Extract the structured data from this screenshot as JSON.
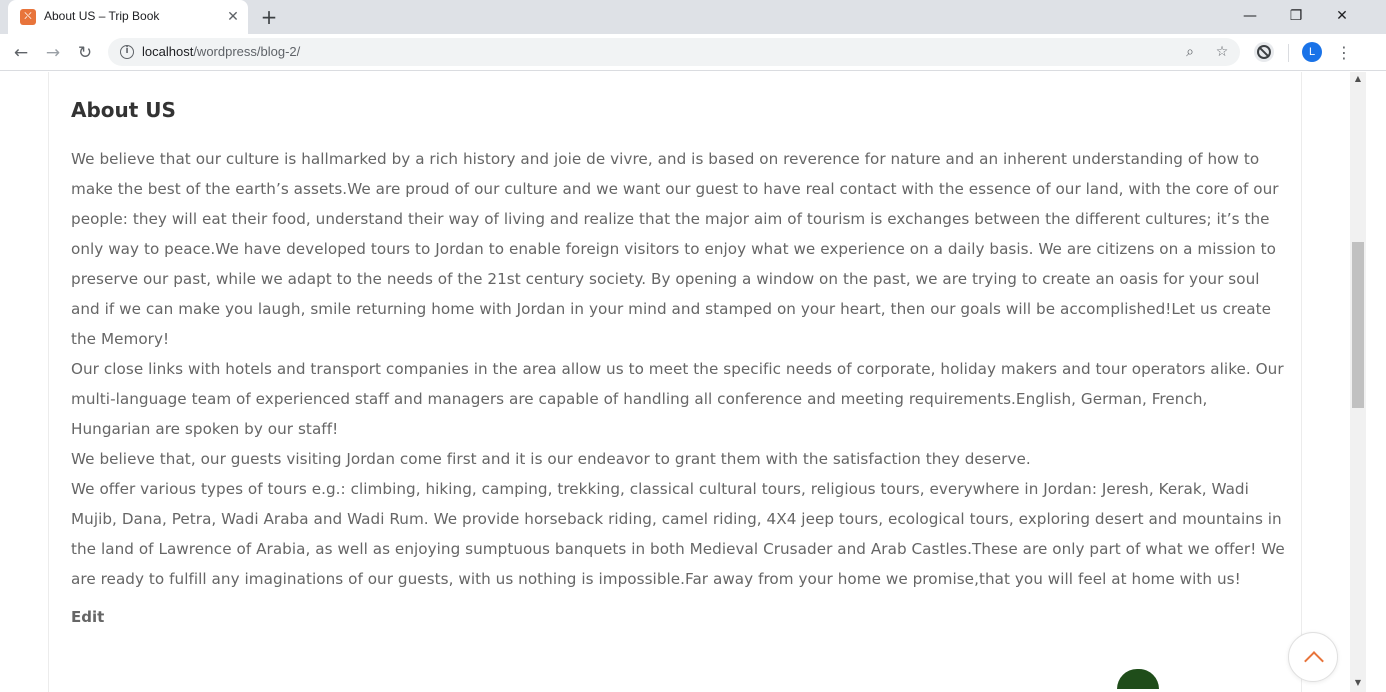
{
  "browser": {
    "tab_title": "About US – Trip Book",
    "tab_favicon": "xampp-icon",
    "url_host": "localhost",
    "url_path": "/wordpress/blog-2/",
    "avatar_letter": "L",
    "icons": {
      "back": "back-arrow-icon",
      "forward": "forward-arrow-icon",
      "reload": "reload-icon",
      "zoom": "zoom-icon",
      "bookmark": "star-icon",
      "extension": "block-icon",
      "menu": "more-vert-icon"
    }
  },
  "page": {
    "title": "About US",
    "paragraphs": [
      "We believe that our culture is hallmarked by a rich history and joie de vivre, and is based on reverence for nature and an inherent understanding of how to make the best of the earth’s assets.We are proud of our culture and we want our guest to have real contact with the essence of our land, with the core of our people: they will eat their food, understand their way of living and realize that the major aim of tourism is exchanges between the different cultures; it’s the only way to peace.We have developed tours to Jordan to enable foreign visitors to enjoy what we experience on a daily basis. We are citizens on a mission to preserve our past, while we adapt to the needs of the 21st century society. By opening a window on the past, we are trying to create an oasis for your soul and if we can make you laugh, smile returning home with Jordan in your mind and stamped on your heart, then our goals will be accomplished!Let us create the Memory!",
      "Our close links with hotels and transport companies in the area allow us to meet the specific needs of corporate, holiday makers and tour operators alike. Our multi-language team of experienced staff and managers are capable of handling all conference and meeting requirements.English, German, French, Hungarian are spoken by our staff!",
      "We believe that, our guests visiting Jordan come first and it is our endeavor to grant them with the satisfaction they deserve.",
      "We offer various types of tours e.g.: climbing, hiking, camping, trekking, classical cultural tours, religious tours, everywhere in Jordan: Jeresh, Kerak, Wadi Mujib, Dana, Petra, Wadi Araba and Wadi Rum. We provide horseback riding, camel riding, 4X4 jeep tours, ecological tours, exploring desert and mountains in the land of Lawrence of Arabia, as well as enjoying sumptuous banquets in both Medieval Crusader and Arab Castles.These are only part of what we offer! We are ready to fulfill any imaginations of our guests, with us nothing is impossible.Far away from your home we promise,that you will feel at home with us!"
    ],
    "edit_label": "Edit"
  },
  "colors": {
    "accent": "#e8743b",
    "text": "#666666",
    "heading": "#333333"
  }
}
